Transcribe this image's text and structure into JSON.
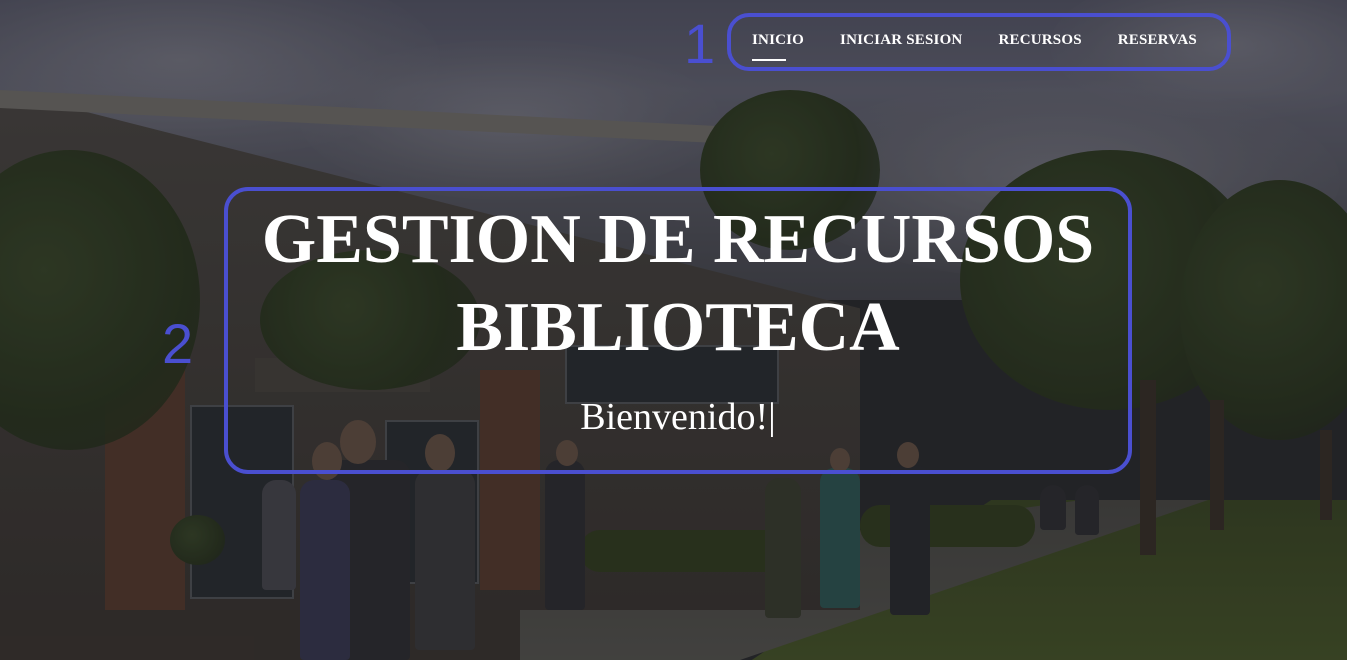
{
  "nav": {
    "items": [
      {
        "label": "INICIO",
        "active": true
      },
      {
        "label": "INICIAR SESION",
        "active": false
      },
      {
        "label": "RECURSOS",
        "active": false
      },
      {
        "label": "RESERVAS",
        "active": false
      }
    ]
  },
  "hero": {
    "title_line1": "GESTION DE RECURSOS",
    "title_line2": "BIBLIOTECA",
    "subtitle": "Bienvenido!|"
  },
  "annotations": {
    "marker_1": "1",
    "marker_2": "2",
    "color": "#4a4fd0"
  },
  "colors": {
    "text": "#ffffff",
    "overlay": "rgba(20,20,22,0.35)"
  }
}
